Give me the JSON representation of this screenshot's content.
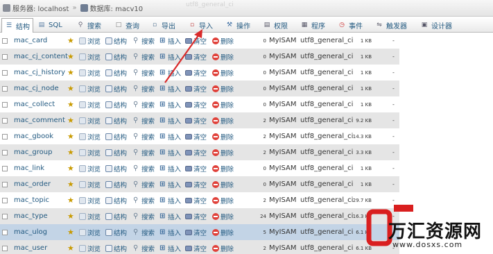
{
  "titlebar": {
    "server_label": "服务器: localhost",
    "separator": "»",
    "database_label": "数据库: macv10",
    "ghost_text": "utf8_general_ci"
  },
  "tabs": [
    {
      "label": "结构",
      "icon": "structure-icon",
      "active": true
    },
    {
      "label": "SQL",
      "icon": "sql-icon",
      "active": false
    },
    {
      "label": "搜索",
      "icon": "search-icon",
      "active": false
    },
    {
      "label": "查询",
      "icon": "query-icon",
      "active": false
    },
    {
      "label": "导出",
      "icon": "export-icon",
      "active": false
    },
    {
      "label": "导入",
      "icon": "import-icon",
      "active": false
    },
    {
      "label": "操作",
      "icon": "wrench-icon",
      "active": false
    },
    {
      "label": "权限",
      "icon": "privileges-icon",
      "active": false
    },
    {
      "label": "程序",
      "icon": "routines-icon",
      "active": false
    },
    {
      "label": "事件",
      "icon": "clock-icon",
      "active": false
    },
    {
      "label": "触发器",
      "icon": "triggers-icon",
      "active": false
    },
    {
      "label": "设计器",
      "icon": "designer-icon",
      "active": false
    }
  ],
  "actions": {
    "browse": "浏览",
    "structure": "结构",
    "search": "搜索",
    "insert": "插入",
    "empty": "清空",
    "drop": "删除"
  },
  "tables": [
    {
      "name": "mac_card",
      "rows": "0",
      "engine": "MyISAM",
      "collation": "utf8_general_ci",
      "size": "1 KB",
      "overhead": "-"
    },
    {
      "name": "mac_cj_content",
      "rows": "0",
      "engine": "MyISAM",
      "collation": "utf8_general_ci",
      "size": "1 KB",
      "overhead": "-"
    },
    {
      "name": "mac_cj_history",
      "rows": "0",
      "engine": "MyISAM",
      "collation": "utf8_general_ci",
      "size": "1 KB",
      "overhead": "-"
    },
    {
      "name": "mac_cj_node",
      "rows": "0",
      "engine": "MyISAM",
      "collation": "utf8_general_ci",
      "size": "1 KB",
      "overhead": "-"
    },
    {
      "name": "mac_collect",
      "rows": "0",
      "engine": "MyISAM",
      "collation": "utf8_general_ci",
      "size": "1 KB",
      "overhead": "-"
    },
    {
      "name": "mac_comment",
      "rows": "2",
      "engine": "MyISAM",
      "collation": "utf8_general_ci",
      "size": "9.2 KB",
      "overhead": "-"
    },
    {
      "name": "mac_gbook",
      "rows": "2",
      "engine": "MyISAM",
      "collation": "utf8_general_ci",
      "size": "14.3 KB",
      "overhead": "-"
    },
    {
      "name": "mac_group",
      "rows": "2",
      "engine": "MyISAM",
      "collation": "utf8_general_ci",
      "size": "3.3 KB",
      "overhead": "-"
    },
    {
      "name": "mac_link",
      "rows": "0",
      "engine": "MyISAM",
      "collation": "utf8_general_ci",
      "size": "1 KB",
      "overhead": "-"
    },
    {
      "name": "mac_order",
      "rows": "0",
      "engine": "MyISAM",
      "collation": "utf8_general_ci",
      "size": "1 KB",
      "overhead": "-"
    },
    {
      "name": "mac_topic",
      "rows": "2",
      "engine": "MyISAM",
      "collation": "utf8_general_ci",
      "size": "29.7 KB",
      "overhead": "-"
    },
    {
      "name": "mac_type",
      "rows": "24",
      "engine": "MyISAM",
      "collation": "utf8_general_ci",
      "size": "16.3 KB",
      "overhead": "-"
    },
    {
      "name": "mac_ulog",
      "rows": "5",
      "engine": "MyISAM",
      "collation": "utf8_general_ci",
      "size": "6.1 KB",
      "overhead": "-"
    },
    {
      "name": "mac_user",
      "rows": "2",
      "engine": "MyISAM",
      "collation": "utf8_general_ci",
      "size": "6.1 KB",
      "overhead": "-"
    }
  ],
  "watermark": {
    "brand": "万汇资源网",
    "url": "www.dosxs.com",
    "accent": "#d91f1f"
  },
  "colors": {
    "link": "#235a81",
    "annotation_arrow": "#d92a2a",
    "row_alt": "#e5e5e5",
    "row_selected": "#c3d4e6"
  }
}
